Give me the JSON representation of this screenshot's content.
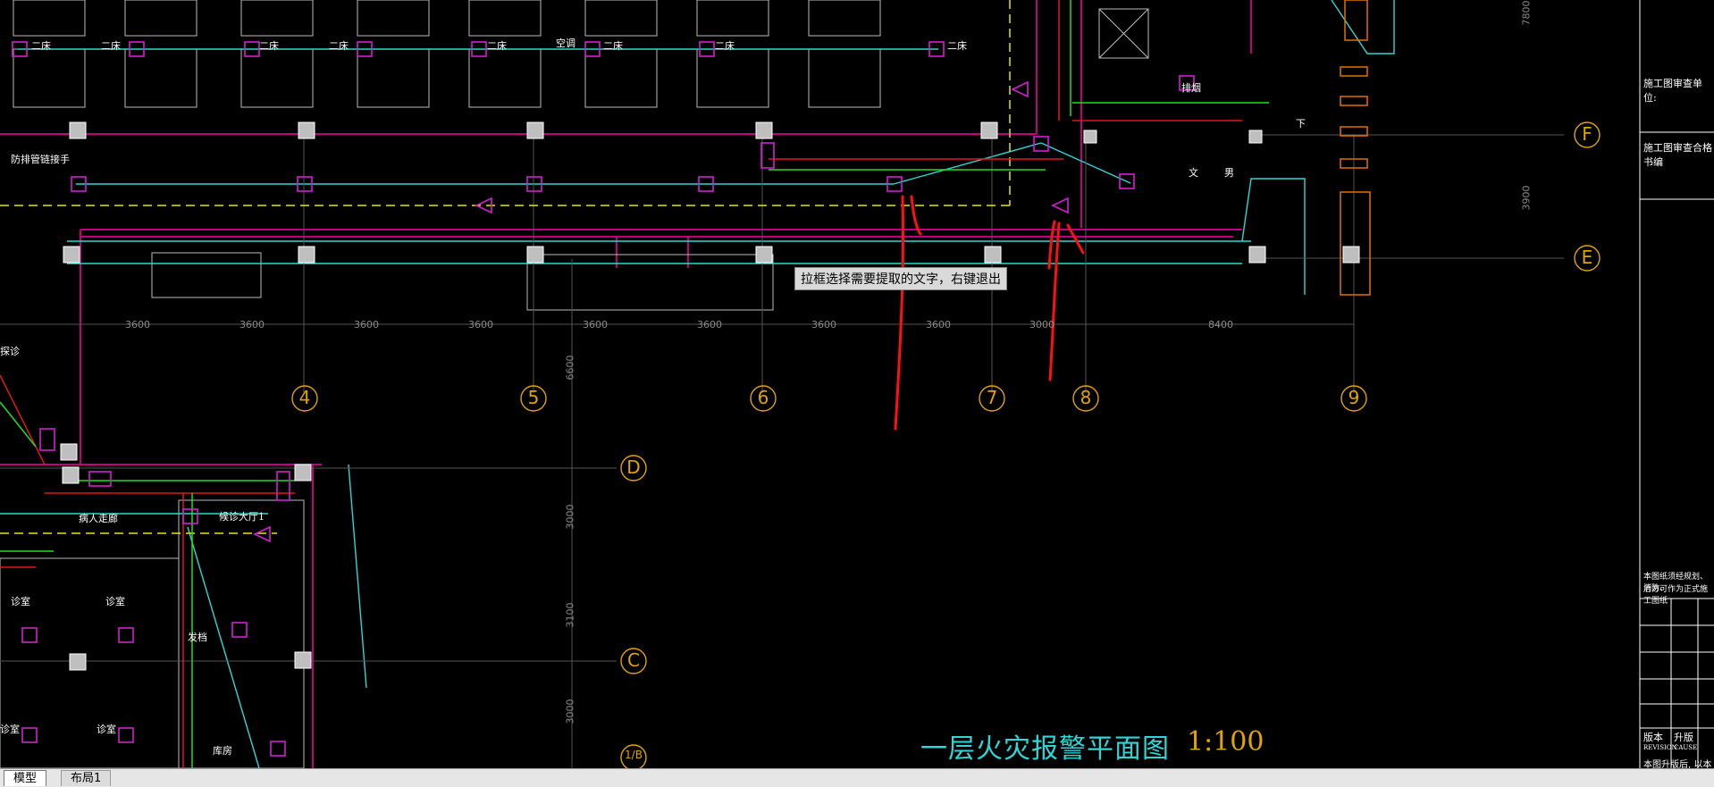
{
  "tooltip": "拉框选择需要提取的文字，右键退出",
  "drawing_title": "一层火灾报警平面图",
  "drawing_scale": "1:100",
  "tabs": [
    {
      "label": "模型",
      "active": true
    },
    {
      "label": "布局1",
      "active": false
    }
  ],
  "grid_columns": [
    "4",
    "5",
    "6",
    "7",
    "8",
    "9"
  ],
  "grid_rows": [
    "F",
    "E",
    "D",
    "C",
    "1/B"
  ],
  "dimensions": [
    "3600",
    "3600",
    "3600",
    "3600",
    "3600",
    "3600",
    "3600",
    "3600",
    "3000",
    "8400"
  ],
  "vertical_dimensions": [
    "7800",
    "3900",
    "6600",
    "3000",
    "3100",
    "3000"
  ],
  "title_block": {
    "review_unit": "施工图审查单位:",
    "review_cert": "施工图审查合格书编",
    "note_line1": "本图纸须经规划、消防、",
    "note_line2": "后方可作为正式施工图纸",
    "revision_label": "版本",
    "revision_en": "REVISION",
    "cause_label": "升版",
    "cause_en": "CAUSE",
    "bottom_note": "本图升版后, 以本"
  },
  "room_labels": [
    "二床",
    "二床",
    "二床",
    "二床",
    "二床",
    "二床",
    "二床",
    "空调",
    "二床",
    "防排管链接手",
    "诊室",
    "候诊大厅1",
    "病人走廊",
    "诊室",
    "诊室",
    "发档",
    "诊室",
    "探诊",
    "库房",
    "文",
    "男",
    "下",
    "排烟"
  ],
  "colors": {
    "background": "#000000",
    "wall": "#c0007a",
    "device": "#d020d0",
    "cyan": "#2fd6d6",
    "green": "#22dd22",
    "red": "#e01818",
    "yellow": "#e8e800",
    "grid": "#e0a400",
    "white": "#ffffff"
  }
}
